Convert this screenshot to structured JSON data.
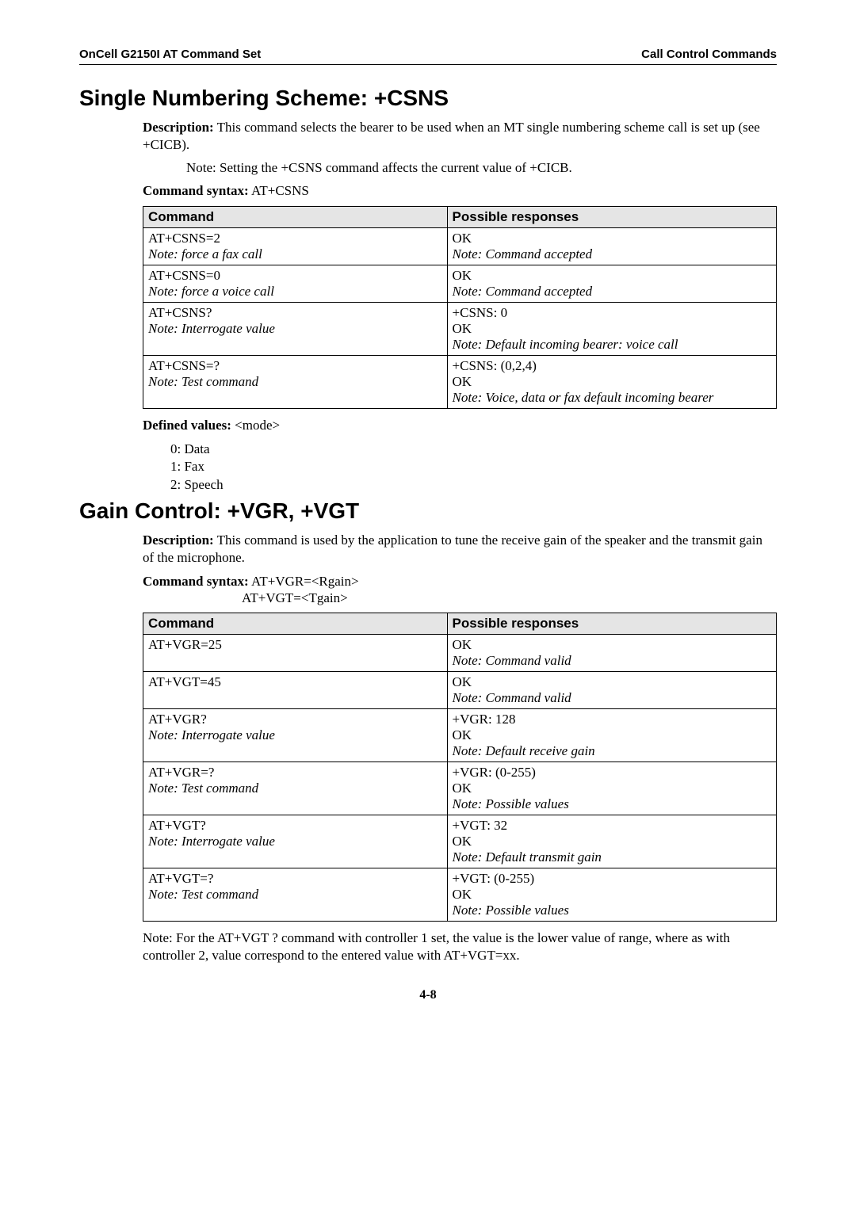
{
  "header": {
    "left": "OnCell G2150I AT Command Set",
    "right": "Call Control Commands"
  },
  "csns": {
    "title": "Single Numbering Scheme: +CSNS",
    "desc_label": "Description:",
    "desc_text": " This command selects the bearer to be used when an MT single numbering scheme call is set up (see +CICB).",
    "note": "Note: Setting the +CSNS command affects the current value of +CICB.",
    "syntax_label": "Command syntax:",
    "syntax_text": " AT+CSNS",
    "th1": "Command",
    "th2": "Possible responses",
    "rows": [
      {
        "c1a": "AT+CSNS=2",
        "c1b": "Note: force a fax call",
        "c2a": "OK",
        "c2b": "Note: Command accepted"
      },
      {
        "c1a": "AT+CSNS=0",
        "c1b": "Note: force a voice call",
        "c2a": "OK",
        "c2b": "Note: Command accepted"
      },
      {
        "c1a": "AT+CSNS?",
        "c1b": "Note: Interrogate value",
        "c2a": "+CSNS: 0",
        "c2b": "OK",
        "c2c": "Note: Default incoming bearer: voice call"
      },
      {
        "c1a": "AT+CSNS=?",
        "c1b": "Note: Test command",
        "c2a": "+CSNS: (0,2,4)",
        "c2b": "OK",
        "c2c": "Note: Voice, data or fax default incoming bearer"
      }
    ],
    "defined_label": "Defined values:",
    "defined_param": " <mode>",
    "defined_values": [
      "0: Data",
      "1: Fax",
      "2: Speech"
    ]
  },
  "gain": {
    "title": "Gain Control: +VGR, +VGT",
    "desc_label": "Description:",
    "desc_text": " This command is used by the application to tune the receive gain of the speaker and the transmit gain of the microphone.",
    "syntax_label": "Command syntax:",
    "syntax_text1": " AT+VGR=<Rgain>",
    "syntax_text2": "AT+VGT=<Tgain>",
    "th1": "Command",
    "th2": "Possible responses",
    "rows": [
      {
        "c1a": "AT+VGR=25",
        "c2a": "OK",
        "c2b": "Note: Command valid"
      },
      {
        "c1a": "AT+VGT=45",
        "c2a": "OK",
        "c2b": "Note: Command valid"
      },
      {
        "c1a": "AT+VGR?",
        "c1b": "Note: Interrogate value",
        "c2a": "+VGR: 128",
        "c2b": "OK",
        "c2c": "Note: Default receive gain"
      },
      {
        "c1a": "AT+VGR=?",
        "c1b": "Note: Test command",
        "c2a": "+VGR: (0-255)",
        "c2b": "OK",
        "c2c": "Note: Possible values"
      },
      {
        "c1a": "AT+VGT?",
        "c1b": "Note: Interrogate value",
        "c2a": "+VGT: 32",
        "c2b": "OK",
        "c2c": "Note: Default transmit gain"
      },
      {
        "c1a": "AT+VGT=?",
        "c1b": "Note: Test command",
        "c2a": "+VGT: (0-255)",
        "c2b": "OK",
        "c2c": "Note: Possible values"
      }
    ],
    "footnote": "Note: For the AT+VGT ? command with controller 1 set, the value is the lower value of range, where as with controller 2, value correspond to the entered value with AT+VGT=xx."
  },
  "page_number": "4-8",
  "chart_data": {
    "type": "table",
    "tables": [
      {
        "title": "Single Numbering Scheme: +CSNS",
        "columns": [
          "Command",
          "Possible responses"
        ],
        "rows": [
          [
            "AT+CSNS=2 (force a fax call)",
            "OK — Command accepted"
          ],
          [
            "AT+CSNS=0 (force a voice call)",
            "OK — Command accepted"
          ],
          [
            "AT+CSNS? (Interrogate value)",
            "+CSNS: 0 / OK — Default incoming bearer: voice call"
          ],
          [
            "AT+CSNS=? (Test command)",
            "+CSNS: (0,2,4) / OK — Voice, data or fax default incoming bearer"
          ]
        ]
      },
      {
        "title": "Gain Control: +VGR, +VGT",
        "columns": [
          "Command",
          "Possible responses"
        ],
        "rows": [
          [
            "AT+VGR=25",
            "OK — Command valid"
          ],
          [
            "AT+VGT=45",
            "OK — Command valid"
          ],
          [
            "AT+VGR? (Interrogate value)",
            "+VGR: 128 / OK — Default receive gain"
          ],
          [
            "AT+VGR=? (Test command)",
            "+VGR: (0-255) / OK — Possible values"
          ],
          [
            "AT+VGT? (Interrogate value)",
            "+VGT: 32 / OK — Default transmit gain"
          ],
          [
            "AT+VGT=? (Test command)",
            "+VGT: (0-255) / OK — Possible values"
          ]
        ]
      }
    ]
  }
}
